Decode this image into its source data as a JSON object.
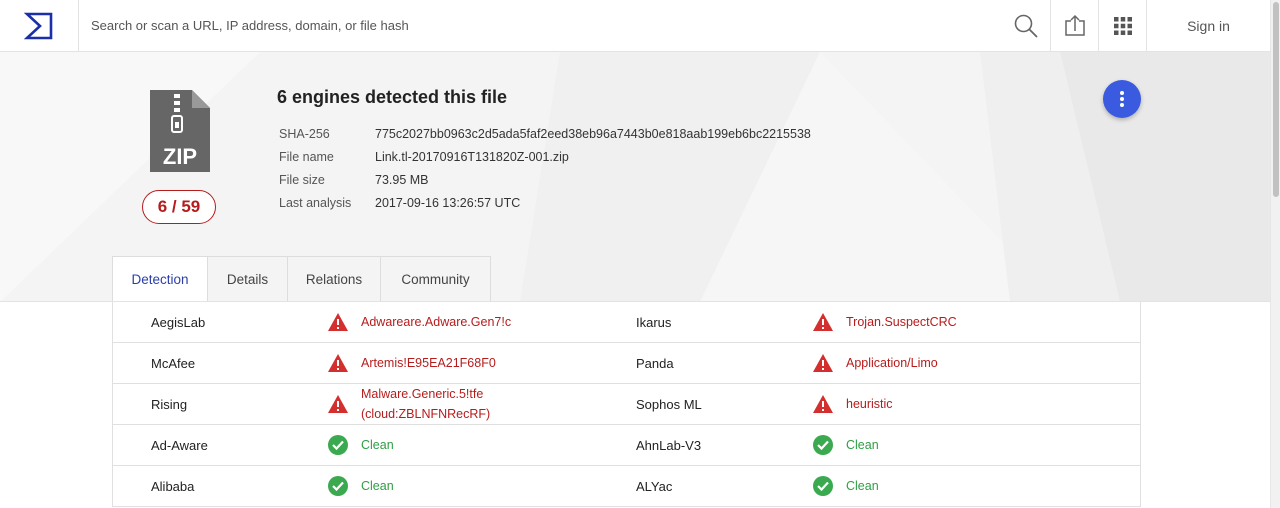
{
  "header": {
    "search_placeholder": "Search or scan a URL, IP address, domain, or file hash",
    "signin_label": "Sign in"
  },
  "file": {
    "type_label": "ZIP",
    "score": "6 / 59",
    "title": "6 engines detected this file",
    "details": [
      {
        "label": "SHA-256",
        "value": "775c2027bb0963c2d5ada5faf2eed38eb96a7443b0e818aab199eb6bc2215538"
      },
      {
        "label": "File name",
        "value": "Link.tl-20170916T131820Z-001.zip"
      },
      {
        "label": "File size",
        "value": "73.95 MB"
      },
      {
        "label": "Last analysis",
        "value": "2017-09-16 13:26:57 UTC"
      }
    ]
  },
  "tabs": [
    {
      "label": "Detection",
      "active": true
    },
    {
      "label": "Details",
      "active": false
    },
    {
      "label": "Relations",
      "active": false
    },
    {
      "label": "Community",
      "active": false
    }
  ],
  "results": [
    {
      "left": {
        "engine": "AegisLab",
        "result": "Adwareare.Adware.Gen7!c",
        "status": "malicious"
      },
      "right": {
        "engine": "Ikarus",
        "result": "Trojan.SuspectCRC",
        "status": "malicious"
      }
    },
    {
      "left": {
        "engine": "McAfee",
        "result": "Artemis!E95EA21F68F0",
        "status": "malicious"
      },
      "right": {
        "engine": "Panda",
        "result": "Application/Limo",
        "status": "malicious"
      }
    },
    {
      "left": {
        "engine": "Rising",
        "result": "Malware.Generic.5!tfe",
        "result2": "(cloud:ZBLNFNRecRF)",
        "status": "malicious"
      },
      "right": {
        "engine": "Sophos ML",
        "result": "heuristic",
        "status": "malicious"
      }
    },
    {
      "left": {
        "engine": "Ad-Aware",
        "result": "Clean",
        "status": "clean"
      },
      "right": {
        "engine": "AhnLab-V3",
        "result": "Clean",
        "status": "clean"
      }
    },
    {
      "left": {
        "engine": "Alibaba",
        "result": "Clean",
        "status": "clean"
      },
      "right": {
        "engine": "ALYac",
        "result": "Clean",
        "status": "clean"
      }
    }
  ],
  "colors": {
    "accent": "#3a5be0",
    "brand": "#1a2fa8",
    "malicious": "#b71c1c",
    "clean": "#2f9e44"
  },
  "icons": {
    "logo": "sigma-logo-icon",
    "search": "search-icon",
    "upload": "upload-icon",
    "apps": "grid-apps-icon",
    "file": "zip-file-icon",
    "more": "more-vertical-icon",
    "malicious": "warning-triangle-icon",
    "clean": "check-circle-icon"
  }
}
